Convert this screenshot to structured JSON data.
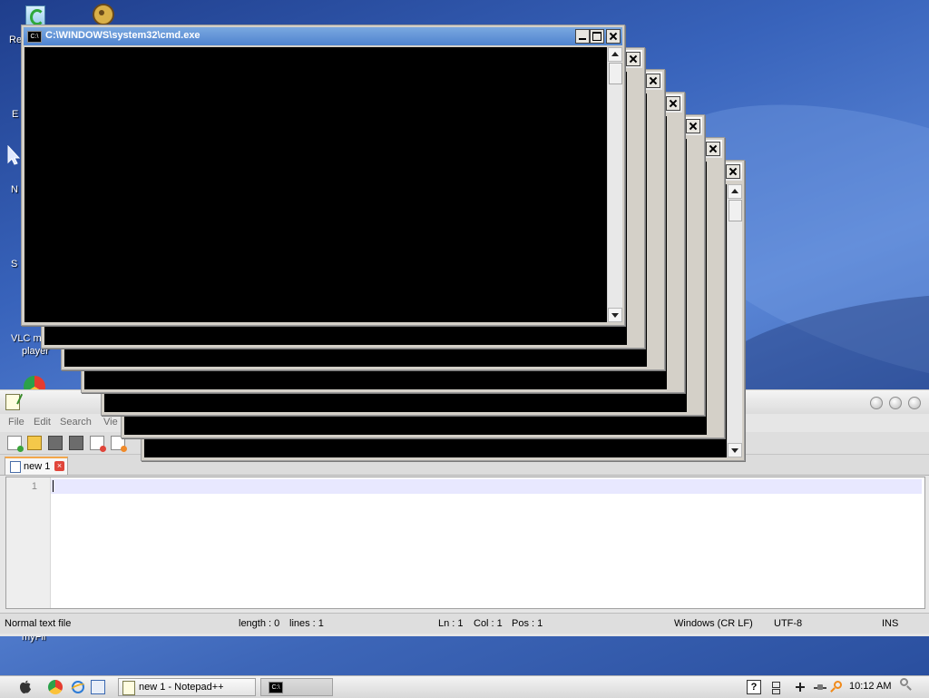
{
  "desktop": {
    "labels": [
      "Re",
      "E",
      "N",
      "S",
      "VLC m",
      "player",
      "myFil"
    ]
  },
  "cmd": {
    "title": "C:\\WINDOWS\\system32\\cmd.exe",
    "icon_text": "C:\\"
  },
  "notepad": {
    "menu": [
      "File",
      "Edit",
      "Search",
      "Vie"
    ],
    "close_x": "X",
    "tab_label": "new 1",
    "tab_close": "×",
    "line_number": "1",
    "status": {
      "file_type": "Normal text file",
      "length": "length : 0",
      "lines": "lines : 1",
      "ln": "Ln : 1",
      "col": "Col : 1",
      "pos": "Pos : 1",
      "eol": "Windows (CR LF)",
      "encoding": "UTF-8",
      "mode": "INS"
    }
  },
  "taskbar": {
    "notepad_task": "new 1 - Notepad++",
    "cmd_task_icon": "C:\\",
    "clock": "10:12 AM",
    "help_glyph": "?"
  },
  "colors": {
    "active_title": "#4f83cf",
    "tab_accent": "#f3a74b",
    "tab_close": "#e0453a",
    "console": "#000000"
  }
}
